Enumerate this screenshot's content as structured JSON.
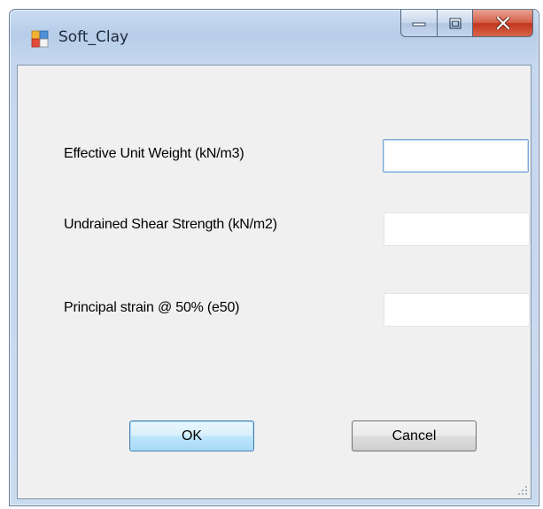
{
  "window": {
    "title": "Soft_Clay",
    "icon": "winforms-app-icon",
    "controls": [
      "minimize-icon",
      "maximize-icon",
      "close-icon"
    ]
  },
  "form": {
    "fields": [
      {
        "label": "Effective Unit Weight (kN/m3)",
        "value": "",
        "focused": true
      },
      {
        "label": "Undrained Shear Strength (kN/m2)",
        "value": "",
        "focused": false
      },
      {
        "label": "Principal strain @ 50% (e50)",
        "value": "",
        "focused": false
      }
    ],
    "ok_label": "OK",
    "cancel_label": "Cancel"
  },
  "colors": {
    "title_bar": "#b9cfe9",
    "client_bg": "#f0f0f0",
    "close_button": "#c9432b",
    "default_button_border": "#3c7fb1"
  }
}
